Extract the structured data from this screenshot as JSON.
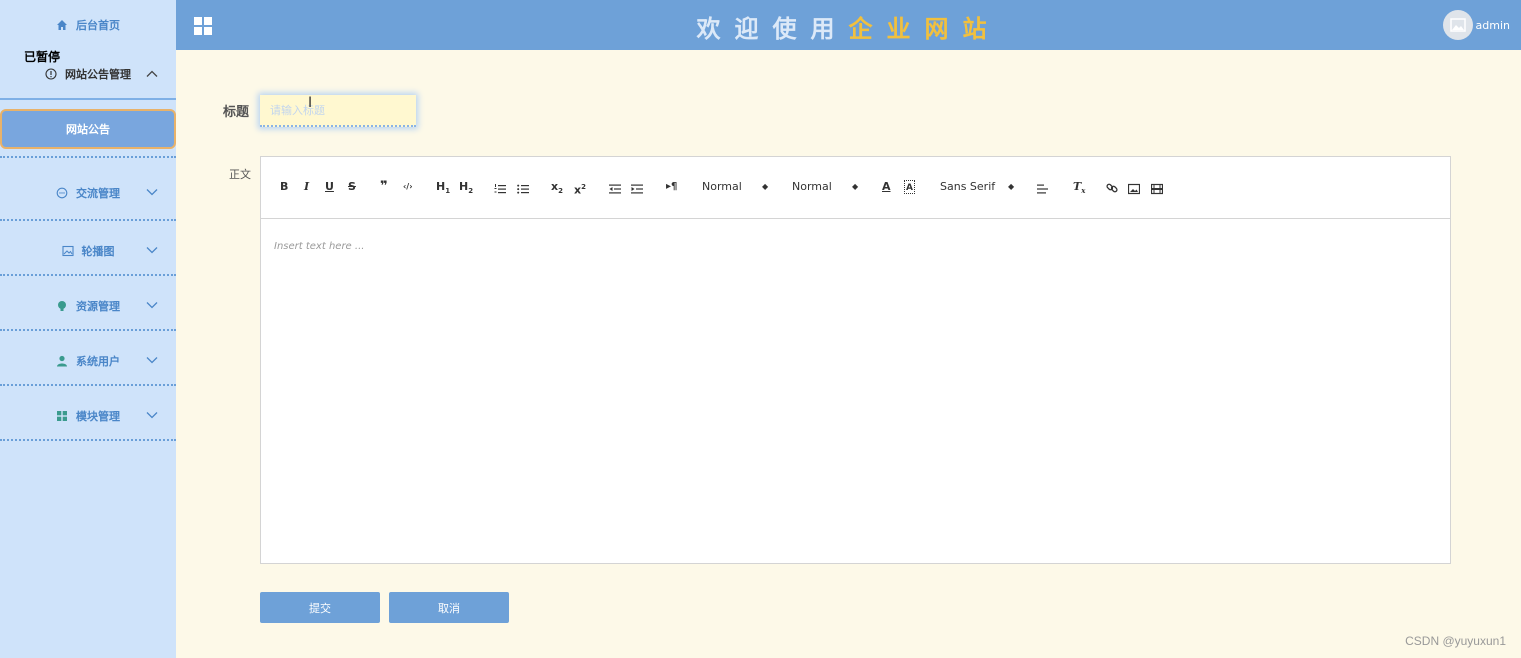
{
  "sidebar": {
    "home_label": "后台首页",
    "overlay_label": "已暂停",
    "open_menu_label": "网站公告管理",
    "active_item_label": "网站公告",
    "items": [
      {
        "label": "交流管理",
        "icon": "chat-icon"
      },
      {
        "label": "轮播图",
        "icon": "image-icon"
      },
      {
        "label": "资源管理",
        "icon": "bulb-icon"
      },
      {
        "label": "系统用户",
        "icon": "user-icon"
      },
      {
        "label": "模块管理",
        "icon": "grid-icon"
      }
    ]
  },
  "header": {
    "title_part1": "欢迎使用",
    "title_part2": "企业网站",
    "username": "admin"
  },
  "form": {
    "title_label": "标题",
    "title_placeholder": "请输入标题",
    "body_label": "正文",
    "editor_placeholder": "Insert text here ...",
    "submit_label": "提交",
    "cancel_label": "取消"
  },
  "toolbar": {
    "header_select": "Normal",
    "size_select": "Normal",
    "font_select": "Sans Serif"
  },
  "watermark": "CSDN @yuyuxun1",
  "colors": {
    "header_bg": "#6ea1d8",
    "sidebar_bg": "#cfe3fa",
    "page_bg": "#fdf9e8",
    "title_highlight": "#f2c03d"
  }
}
